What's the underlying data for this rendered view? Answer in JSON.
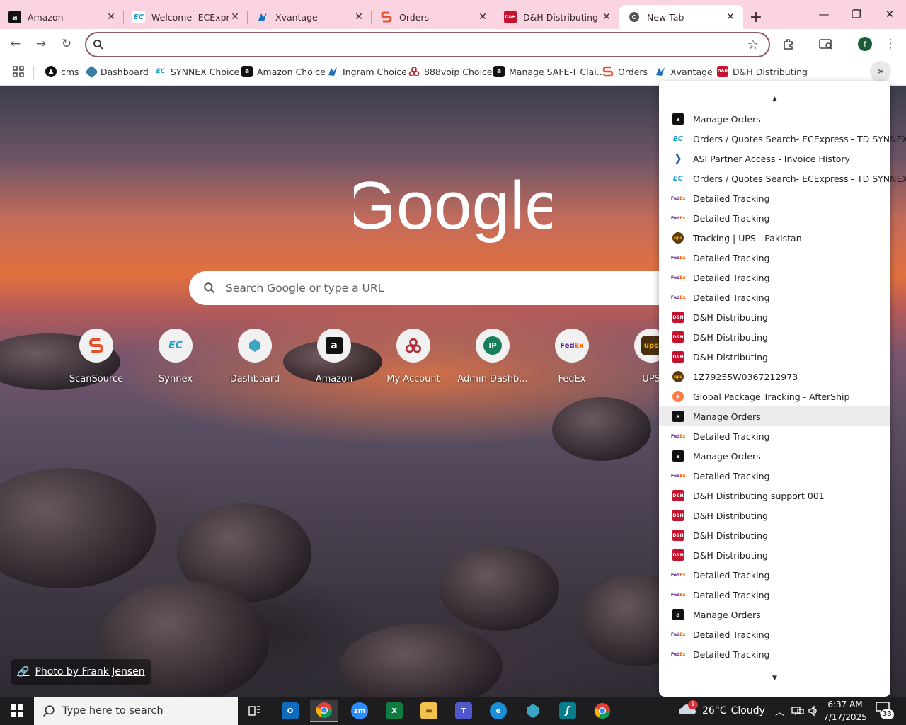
{
  "tabs": [
    {
      "title": "Amazon",
      "icon": "amazon-icon",
      "fav_text": "a",
      "fav_class": "ic-amazon",
      "active": false
    },
    {
      "title": "Welcome- ECExpress",
      "icon": "ec-icon",
      "fav_text": "EC",
      "fav_class": "ic-ec",
      "active": false
    },
    {
      "title": "Xvantage",
      "icon": "xvantage-icon",
      "fav_text": "",
      "fav_class": "ic-asi",
      "active": false
    },
    {
      "title": "Orders",
      "icon": "scansource-icon",
      "fav_text": "S",
      "fav_class": "ic-aftership",
      "active": false
    },
    {
      "title": "D&H Distributing",
      "icon": "dh-icon",
      "fav_text": "D&H",
      "fav_class": "ic-dh",
      "active": false
    },
    {
      "title": "New Tab",
      "icon": "chrome-icon",
      "fav_text": "",
      "fav_class": "",
      "active": true
    }
  ],
  "toolbar": {
    "address_value": "",
    "profile_initial": "f"
  },
  "bookmarks": [
    {
      "label": "cms",
      "icon": "cms-icon"
    },
    {
      "label": "Dashboard",
      "icon": "dashboard-icon"
    },
    {
      "label": "SYNNEX Choice",
      "icon": "ec-icon"
    },
    {
      "label": "Amazon Choice",
      "icon": "amazon-icon"
    },
    {
      "label": "Ingram Choice",
      "icon": "ingram-icon"
    },
    {
      "label": "888voip Choice",
      "icon": "voip-icon"
    },
    {
      "label": "Manage SAFE-T Clai...",
      "icon": "amazon-icon"
    },
    {
      "label": "Orders",
      "icon": "scansource-icon"
    },
    {
      "label": "Xvantage",
      "icon": "xvantage-icon"
    },
    {
      "label": "D&H Distributing",
      "icon": "dh-icon"
    }
  ],
  "ntp": {
    "logo_text": "Google",
    "search_placeholder": "Search Google or type a URL",
    "shortcuts": [
      {
        "label": "ScanSource",
        "icon": "scansource-icon"
      },
      {
        "label": "Synnex",
        "icon": "ec-icon"
      },
      {
        "label": "Dashboard",
        "icon": "dashboard-icon"
      },
      {
        "label": "Amazon",
        "icon": "amazon-icon"
      },
      {
        "label": "My Account",
        "icon": "myaccount-icon"
      },
      {
        "label": "Admin Dashb...",
        "icon": "ip-icon"
      },
      {
        "label": "FedEx",
        "icon": "fedex-icon"
      },
      {
        "label": "UPS",
        "icon": "ups-icon"
      }
    ],
    "photo_credit": "Photo by Frank Jensen"
  },
  "menu_items": [
    {
      "label": "Manage Orders",
      "icon": "amazon-icon"
    },
    {
      "label": "Orders / Quotes Search- ECExpress - TD SYNNEX",
      "icon": "ec-icon"
    },
    {
      "label": "ASI Partner Access - Invoice History",
      "icon": "asi-icon"
    },
    {
      "label": "Orders / Quotes Search- ECExpress - TD SYNNEX",
      "icon": "ec-icon"
    },
    {
      "label": "Detailed Tracking",
      "icon": "fedex-icon"
    },
    {
      "label": "Detailed Tracking",
      "icon": "fedex-icon"
    },
    {
      "label": "Tracking | UPS - Pakistan",
      "icon": "ups-icon"
    },
    {
      "label": "Detailed Tracking",
      "icon": "fedex-icon"
    },
    {
      "label": "Detailed Tracking",
      "icon": "fedex-icon"
    },
    {
      "label": "Detailed Tracking",
      "icon": "fedex-icon"
    },
    {
      "label": "D&H Distributing",
      "icon": "dh-icon"
    },
    {
      "label": "D&H Distributing",
      "icon": "dh-icon"
    },
    {
      "label": "D&H Distributing",
      "icon": "dh-icon"
    },
    {
      "label": "1Z79255W0367212973",
      "icon": "ups-icon"
    },
    {
      "label": "Global Package Tracking - AfterShip",
      "icon": "aftership-icon"
    },
    {
      "label": "Manage Orders",
      "icon": "amazon-icon"
    },
    {
      "label": "Detailed Tracking",
      "icon": "fedex-icon"
    },
    {
      "label": "Manage Orders",
      "icon": "amazon-icon"
    },
    {
      "label": "Detailed Tracking",
      "icon": "fedex-icon"
    },
    {
      "label": "D&H Distributing support 001",
      "icon": "dh-icon"
    },
    {
      "label": "D&H Distributing",
      "icon": "dh-icon"
    },
    {
      "label": "D&H Distributing",
      "icon": "dh-icon"
    },
    {
      "label": "D&H Distributing",
      "icon": "dh-icon"
    },
    {
      "label": "Detailed Tracking",
      "icon": "fedex-icon"
    },
    {
      "label": "Detailed Tracking",
      "icon": "fedex-icon"
    },
    {
      "label": "Manage Orders",
      "icon": "amazon-icon"
    },
    {
      "label": "Detailed Tracking",
      "icon": "fedex-icon"
    },
    {
      "label": "Detailed Tracking",
      "icon": "fedex-icon"
    }
  ],
  "menu_hover_index": 15,
  "taskbar": {
    "search_placeholder": "Type here to search",
    "weather_temp": "26°C",
    "weather_desc": "Cloudy",
    "weather_badge": "1",
    "time": "6:37 AM",
    "date": "7/17/2025",
    "notification_count": "33"
  }
}
